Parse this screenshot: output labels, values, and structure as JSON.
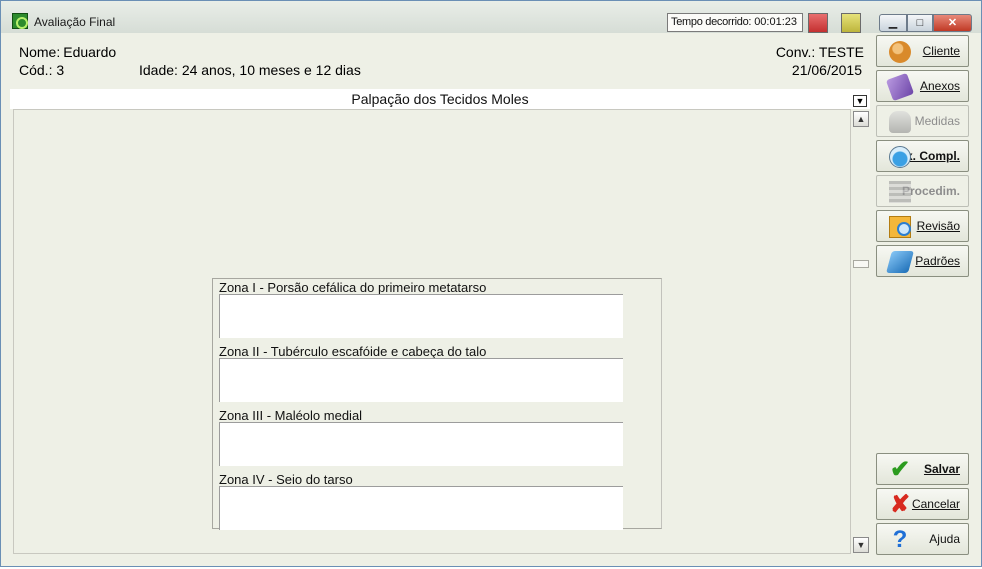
{
  "window": {
    "title": "Avaliação Final",
    "timer_label": "Tempo decorrido:",
    "timer_value": "00:01:23",
    "status_colors": {
      "red": "#d24a4a",
      "yellow": "#d4cf55"
    }
  },
  "patient": {
    "name_label": "Nome:",
    "name_value": "Eduardo",
    "code_text": "Cód.: 3",
    "age_text": "Idade: 24 anos, 10 meses e 12 dias",
    "conv_text": "Conv.: TESTE",
    "date": "21/06/2015"
  },
  "section": {
    "title": "Palpação dos Tecidos Moles"
  },
  "zones": [
    {
      "label": "Zona I - Porsão cefálica do primeiro metatarso",
      "value": ""
    },
    {
      "label": "Zona II - Tubérculo escafóide e cabeça do talo",
      "value": ""
    },
    {
      "label": "Zona III - Maléolo medial",
      "value": ""
    },
    {
      "label": "Zona IV - Seio do tarso",
      "value": ""
    }
  ],
  "sidebar": {
    "cliente": {
      "label": "Cliente",
      "icon": "client-icon",
      "enabled": true
    },
    "anexos": {
      "label": "Anexos",
      "icon": "attachments-icon",
      "enabled": true
    },
    "medidas": {
      "label": "Medidas",
      "icon": "measurements-icon",
      "enabled": false
    },
    "ex_compl": {
      "label": "Ex. Compl.",
      "icon": "exam-icon",
      "enabled": true
    },
    "procedim": {
      "label": "Procedim.",
      "icon": "procedures-icon",
      "enabled": false
    },
    "revisao": {
      "label": "Revisão",
      "icon": "review-icon",
      "enabled": true
    },
    "padroes": {
      "label": "Padrões",
      "icon": "patterns-icon",
      "enabled": true
    }
  },
  "actions": {
    "salvar": {
      "label": "Salvar",
      "icon": "check-icon",
      "glyph": "✔"
    },
    "cancelar": {
      "label": "Cancelar",
      "icon": "cancel-x-icon",
      "glyph": "✘"
    },
    "ajuda": {
      "label": "Ajuda",
      "icon": "help-icon",
      "glyph": "?"
    }
  }
}
